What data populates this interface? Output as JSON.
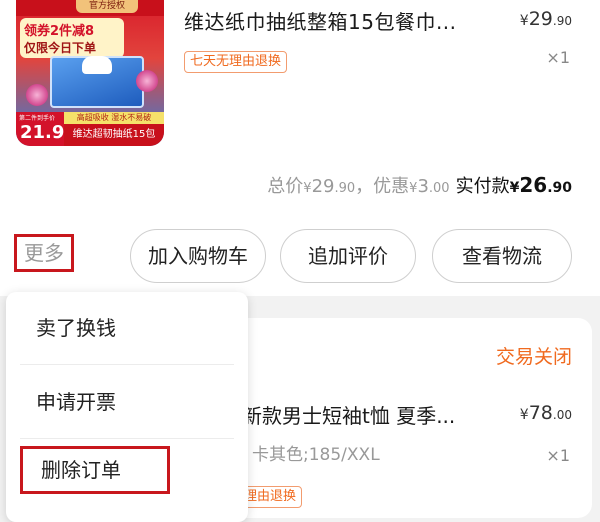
{
  "order1": {
    "thumbnail": {
      "badge": "官方授权",
      "promo_line1": "领券2件减8",
      "promo_line2": "仅限今日下单",
      "price_small": "第二件到手价",
      "price_big": "21.9",
      "strip_text": "高超吸收 湿水不易破",
      "bottom_text": "维达超韧抽纸15包"
    },
    "title": "维达纸巾抽纸整箱15包餐巾...",
    "price": {
      "currency": "¥",
      "integer": "29",
      "decimal": ".90"
    },
    "quantity": "×1",
    "service_tag": "七天无理由退换",
    "summary": {
      "total_label": "总价",
      "total_currency": "¥",
      "total_int": "29",
      "total_dec": ".90",
      "separator": "，",
      "discount_label": "优惠",
      "discount_currency": "¥",
      "discount_int": "3",
      "discount_dec": ".00",
      "paid_label": "实付款",
      "paid_currency": "¥",
      "paid_int": "26",
      "paid_dec": ".90"
    },
    "actions": {
      "more": "更多",
      "add_to_cart": "加入购物车",
      "add_review": "追加评价",
      "view_logistics": "查看物流"
    }
  },
  "more_menu": {
    "items": [
      "卖了换钱",
      "申请开票",
      "删除订单"
    ]
  },
  "order2": {
    "status": "交易关闭",
    "title": "新款男士短袖t恤 夏季...",
    "price": {
      "currency": "¥",
      "integer": "78",
      "decimal": ".00"
    },
    "variant": "卡其色;185/XXL",
    "quantity": "×1",
    "service_tag": "理由退换"
  },
  "colors": {
    "accent_orange": "#f06a1f",
    "highlight_red": "#c8171d"
  }
}
